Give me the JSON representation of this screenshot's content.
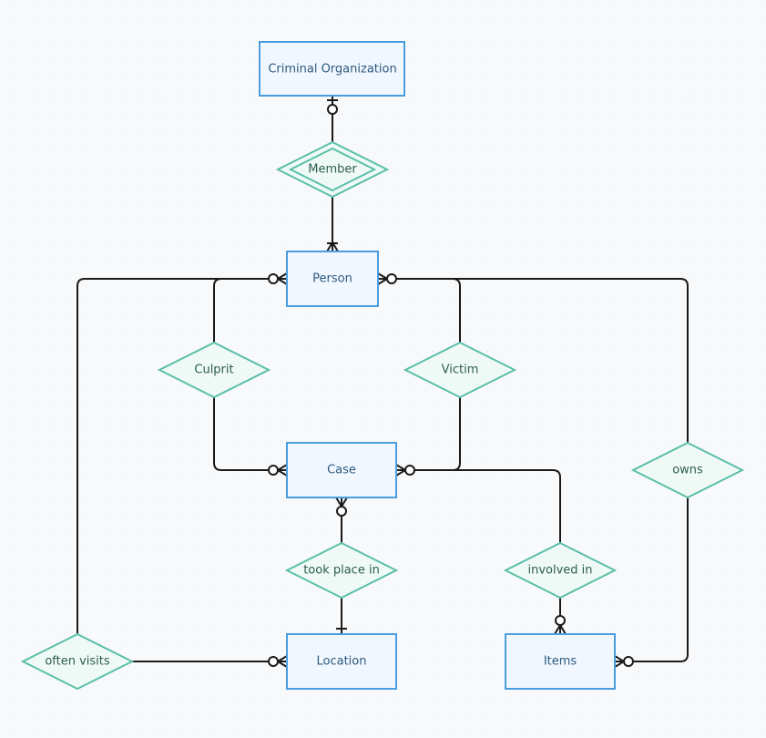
{
  "diagram": {
    "entities": {
      "criminal_organization": "Criminal Organization",
      "person": "Person",
      "case": "Case",
      "location": "Location",
      "items": "Items"
    },
    "relationships": {
      "member": "Member",
      "culprit": "Culprit",
      "victim": "Victim",
      "owns": "owns",
      "took_place_in": "took place in",
      "involved_in": "involved in",
      "often_visits": "often visits"
    },
    "colors": {
      "entity_stroke": "#4a9ee0",
      "entity_fill": "#f0f7fe",
      "relationship_stroke": "#5bbfa8",
      "relationship_fill": "#effaf6",
      "background": "#f8f9fb"
    }
  }
}
